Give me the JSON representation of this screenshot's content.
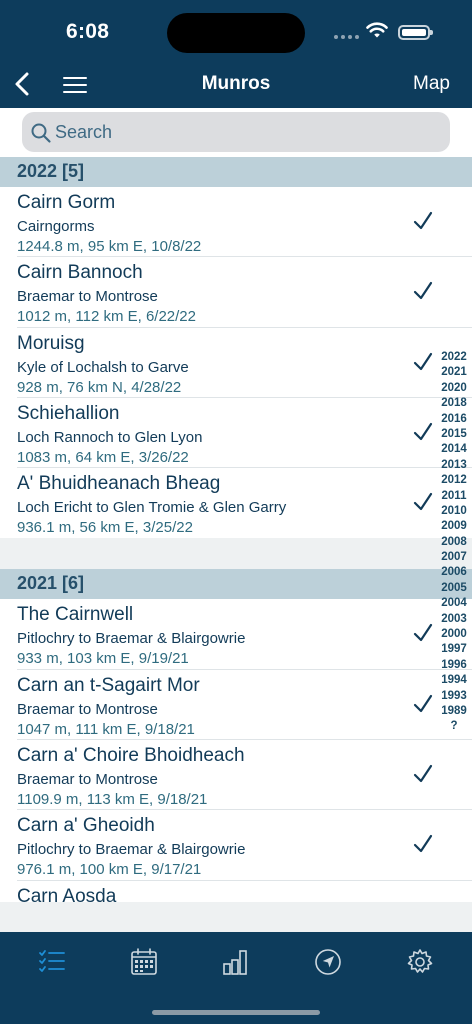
{
  "status": {
    "time": "6:08"
  },
  "nav": {
    "title": "Munros",
    "map_label": "Map"
  },
  "search": {
    "placeholder": "Search"
  },
  "sections": [
    {
      "header": "2022 [5]",
      "rows": [
        {
          "name": "Cairn Gorm",
          "region": "Cairngorms",
          "detail": "1244.8 m, 95 km E, 10/8/22"
        },
        {
          "name": "Cairn Bannoch",
          "region": "Braemar to Montrose",
          "detail": "1012 m, 112 km E, 6/22/22"
        },
        {
          "name": "Moruisg",
          "region": "Kyle of Lochalsh to Garve",
          "detail": "928 m, 76 km N, 4/28/22"
        },
        {
          "name": "Schiehallion",
          "region": "Loch Rannoch to Glen Lyon",
          "detail": "1083 m, 64 km E, 3/26/22"
        },
        {
          "name": "A' Bhuidheanach Bheag",
          "region": "Loch Ericht to Glen Tromie & Glen Garry",
          "detail": "936.1 m, 56 km E, 3/25/22"
        }
      ]
    },
    {
      "header": "2021 [6]",
      "rows": [
        {
          "name": "The Cairnwell",
          "region": "Pitlochry to Braemar & Blairgowrie",
          "detail": "933 m, 103 km E, 9/19/21"
        },
        {
          "name": "Carn an t-Sagairt Mor",
          "region": "Braemar to Montrose",
          "detail": "1047 m, 111 km E, 9/18/21"
        },
        {
          "name": "Carn a' Choire Bhoidheach",
          "region": "Braemar to Montrose",
          "detail": "1109.9 m, 113 km E, 9/18/21"
        },
        {
          "name": "Carn a' Gheoidh",
          "region": "Pitlochry to Braemar & Blairgowrie",
          "detail": "976.1 m, 100 km E, 9/17/21"
        },
        {
          "name": "Carn Aosda",
          "region": "",
          "detail": ""
        }
      ]
    }
  ],
  "year_index": [
    "2022",
    "2021",
    "2020",
    "2018",
    "2016",
    "2015",
    "2014",
    "2013",
    "2012",
    "2011",
    "2010",
    "2009",
    "2008",
    "2007",
    "2006",
    "2005",
    "2004",
    "2003",
    "2000",
    "1997",
    "1996",
    "1994",
    "1993",
    "1989",
    "?"
  ],
  "colors": {
    "nav_bg": "#0d3c5c",
    "section_bg": "#bcd0d9",
    "accent": "#1e8fd6",
    "text": "#123b58"
  },
  "tabs": [
    {
      "icon": "checklist-icon",
      "selected": true
    },
    {
      "icon": "calendar-icon",
      "selected": false
    },
    {
      "icon": "bar-chart-icon",
      "selected": false
    },
    {
      "icon": "compass-icon",
      "selected": false
    },
    {
      "icon": "gear-icon",
      "selected": false
    }
  ]
}
